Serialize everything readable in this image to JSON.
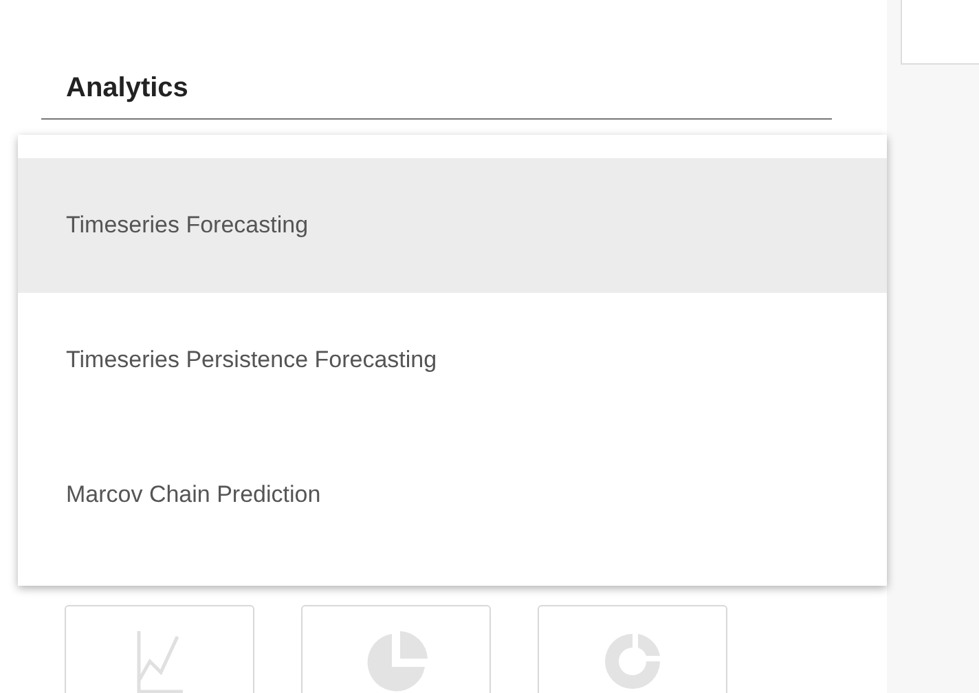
{
  "heading": "Analytics",
  "menu": {
    "items": [
      {
        "label": "Timeseries Forecasting",
        "selected": true
      },
      {
        "label": "Timeseries Persistence Forecasting",
        "selected": false
      },
      {
        "label": "Marcov Chain Prediction",
        "selected": false
      }
    ]
  },
  "chart_buttons": [
    {
      "kind": "line"
    },
    {
      "kind": "pie"
    },
    {
      "kind": "donut"
    }
  ]
}
